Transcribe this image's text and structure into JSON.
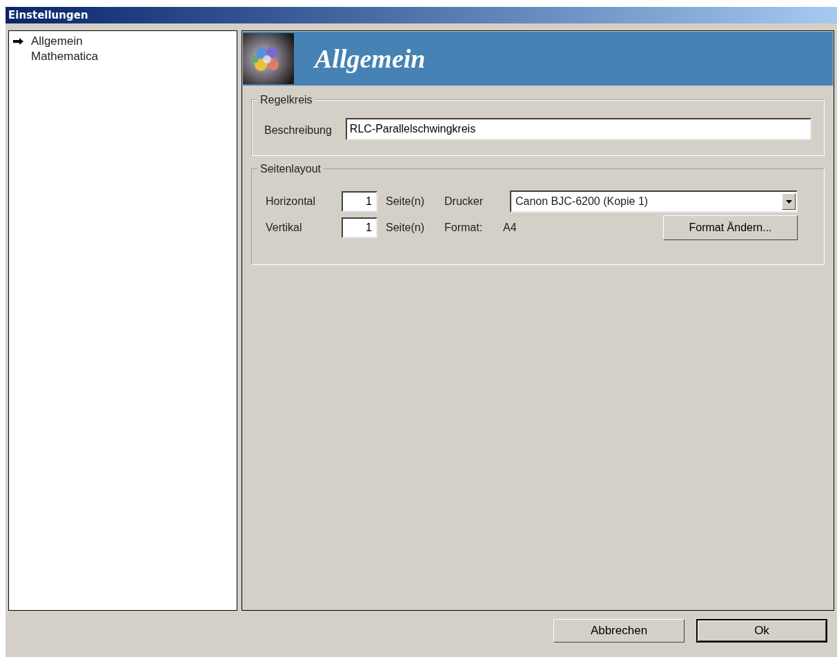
{
  "window": {
    "title": "Einstellungen"
  },
  "sidebar": {
    "items": [
      {
        "label": "Allgemein",
        "selected": true
      },
      {
        "label": "Mathematica",
        "selected": false
      }
    ]
  },
  "header": {
    "title": "Allgemein"
  },
  "groups": {
    "regelkreis": {
      "title": "Regelkreis",
      "description_label": "Beschreibung",
      "description_value": "RLC-Parallelschwingkreis"
    },
    "seitenlayout": {
      "title": "Seitenlayout",
      "horizontal_label": "Horizontal",
      "horizontal_value": "1",
      "horizontal_unit": "Seite(n)",
      "vertical_label": "Vertikal",
      "vertical_value": "1",
      "vertical_unit": "Seite(n)",
      "printer_label": "Drucker",
      "printer_value": "Canon BJC-6200 (Kopie 1)",
      "format_label": "Format:",
      "format_value": "A4",
      "format_button": "Format Ändern..."
    }
  },
  "buttons": [
    {
      "label": "Abbrechen",
      "default": false
    },
    {
      "label": "Ok",
      "default": true
    }
  ]
}
